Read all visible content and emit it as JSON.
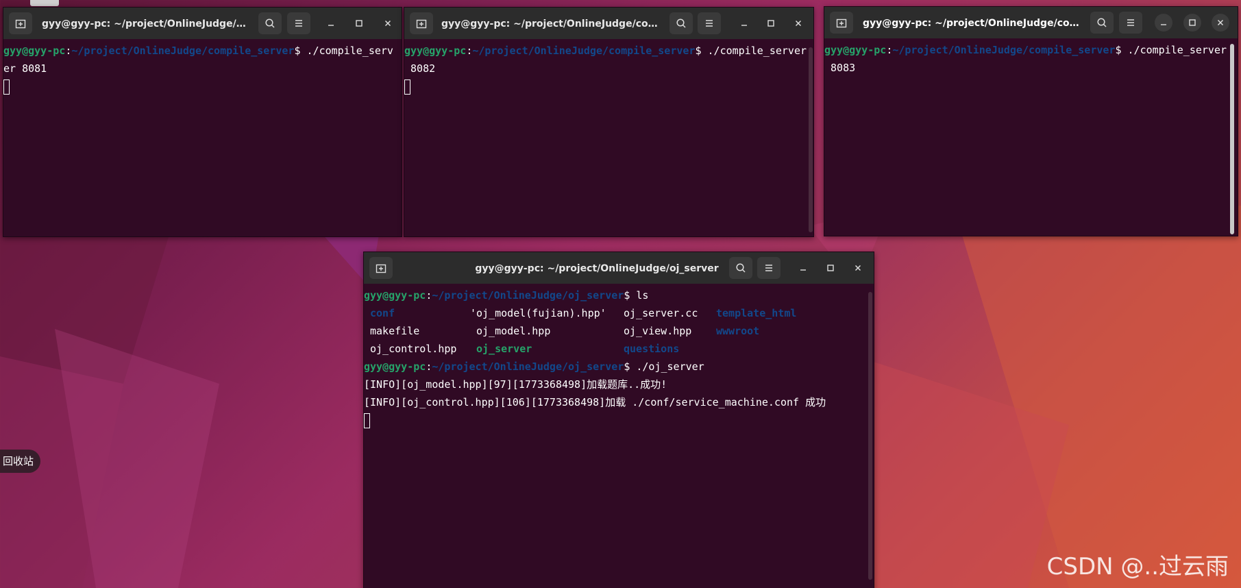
{
  "desktop": {
    "trash_label": "回收站",
    "watermark": "CSDN @..过云雨"
  },
  "terminals": [
    {
      "title": "gyy@gyy-pc: ~/project/OnlineJudge/co...",
      "prompt_user": "gyy@gyy-pc",
      "prompt_path": "~/project/OnlineJudge/compile_server",
      "command_head": "$ ./compile_serv",
      "command_wrap": "er 8081"
    },
    {
      "title": "gyy@gyy-pc: ~/project/OnlineJudge/com...",
      "prompt_user": "gyy@gyy-pc",
      "prompt_path": "~/project/OnlineJudge/compile_server",
      "command_head": "$ ./compile_server",
      "command_wrap": " 8082"
    },
    {
      "title": "gyy@gyy-pc: ~/project/OnlineJudge/com...",
      "prompt_user": "gyy@gyy-pc",
      "prompt_path": "~/project/OnlineJudge/compile_server",
      "command_head": "$ ./compile_server",
      "command_wrap": " 8083"
    },
    {
      "title": "gyy@gyy-pc: ~/project/OnlineJudge/oj_server",
      "prompt_user": "gyy@gyy-pc",
      "prompt_path": "~/project/OnlineJudge/oj_server",
      "command_ls": "$ ls",
      "ls_entries": [
        {
          "name": "conf",
          "kind": "dir"
        },
        {
          "name": "'oj_model(fujian).hpp'",
          "kind": "file"
        },
        {
          "name": "oj_server.cc",
          "kind": "file"
        },
        {
          "name": "template_html",
          "kind": "dir"
        },
        {
          "name": "makefile",
          "kind": "file"
        },
        {
          "name": "oj_model.hpp",
          "kind": "file"
        },
        {
          "name": "oj_view.hpp",
          "kind": "file"
        },
        {
          "name": "wwwroot",
          "kind": "dir"
        },
        {
          "name": "oj_control.hpp",
          "kind": "file"
        },
        {
          "name": "oj_server",
          "kind": "exe"
        },
        {
          "name": "questions",
          "kind": "dir"
        }
      ],
      "command_run": "$ ./oj_server",
      "log_lines": [
        "[INFO][oj_model.hpp][97][1773368498]加载题库..成功!",
        "[INFO][oj_control.hpp][106][1773368498]加载 ./conf/service_machine.conf 成功"
      ]
    }
  ],
  "colors": {
    "terminal_bg": "#300a24",
    "titlebar_bg": "#2c2c2c",
    "prompt_user": "#26a269",
    "prompt_path": "#12488b"
  },
  "icons": [
    "new-tab-icon",
    "search-icon",
    "hamburger-menu-icon",
    "minimize-icon",
    "maximize-icon",
    "close-icon"
  ]
}
